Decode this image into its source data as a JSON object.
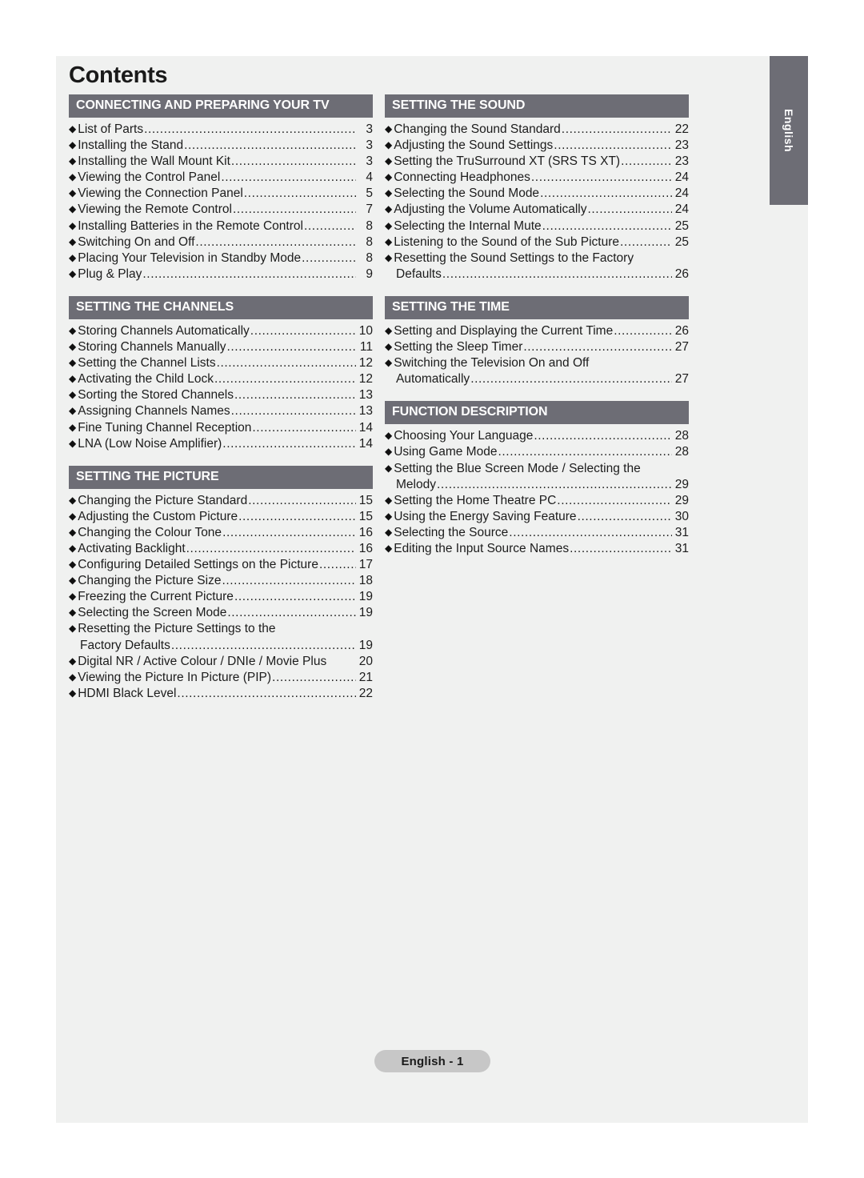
{
  "page": {
    "title": "Contents",
    "language_tab": "English",
    "footer": "English - 1",
    "header_bar_color": "#6d6d75",
    "sheet_color": "#f0f1f0",
    "footer_pill_color": "#c7c7c7",
    "bullet_glyph": "◆"
  },
  "columns": [
    {
      "name": "left",
      "sections": [
        {
          "heading": "CONNECTING AND PREPARING YOUR TV",
          "entries": [
            {
              "label": "List of Parts",
              "page": "3",
              "dots": true,
              "continuation": false
            },
            {
              "label": "Installing the Stand",
              "page": "3",
              "dots": true,
              "continuation": false
            },
            {
              "label": "Installing the Wall Mount Kit",
              "page": "3",
              "dots": true,
              "continuation": false
            },
            {
              "label": "Viewing the Control Panel",
              "page": "4",
              "dots": true,
              "continuation": false
            },
            {
              "label": "Viewing the Connection Panel",
              "page": "5",
              "dots": true,
              "continuation": false
            },
            {
              "label": "Viewing the Remote Control",
              "page": "7",
              "dots": true,
              "continuation": false
            },
            {
              "label": "Installing Batteries in the Remote Control",
              "page": "8",
              "dots": true,
              "continuation": false
            },
            {
              "label": "Switching On and Off",
              "page": "8",
              "dots": true,
              "continuation": false
            },
            {
              "label": "Placing Your Television in Standby Mode",
              "page": "8",
              "dots": true,
              "continuation": false
            },
            {
              "label": "Plug & Play",
              "page": "9",
              "dots": true,
              "continuation": false
            }
          ]
        },
        {
          "heading": "SETTING THE CHANNELS",
          "entries": [
            {
              "label": "Storing Channels Automatically",
              "page": "10",
              "dots": true,
              "continuation": false
            },
            {
              "label": "Storing Channels Manually",
              "page": "11",
              "dots": true,
              "continuation": false
            },
            {
              "label": "Setting the Channel Lists",
              "page": "12",
              "dots": true,
              "continuation": false
            },
            {
              "label": "Activating the Child Lock",
              "page": "12",
              "dots": true,
              "continuation": false
            },
            {
              "label": "Sorting the Stored Channels",
              "page": "13",
              "dots": true,
              "continuation": false
            },
            {
              "label": "Assigning Channels Names",
              "page": "13",
              "dots": true,
              "continuation": false
            },
            {
              "label": "Fine Tuning Channel Reception",
              "page": "14",
              "dots": true,
              "continuation": false
            },
            {
              "label": "LNA (Low Noise Amplifier)",
              "page": "14",
              "dots": true,
              "continuation": false
            }
          ]
        },
        {
          "heading": "SETTING THE PICTURE",
          "entries": [
            {
              "label": "Changing the Picture Standard",
              "page": "15",
              "dots": true,
              "continuation": false
            },
            {
              "label": "Adjusting the Custom Picture",
              "page": "15",
              "dots": true,
              "continuation": false
            },
            {
              "label": "Changing the Colour Tone",
              "page": "16",
              "dots": true,
              "continuation": false
            },
            {
              "label": "Activating Backlight",
              "page": "16",
              "dots": true,
              "continuation": false
            },
            {
              "label": "Configuring Detailed Settings on the Picture",
              "page": "17",
              "dots": true,
              "continuation": false
            },
            {
              "label": "Changing the Picture Size",
              "page": "18",
              "dots": true,
              "continuation": false
            },
            {
              "label": "Freezing the Current Picture",
              "page": "19",
              "dots": true,
              "continuation": false
            },
            {
              "label": "Selecting the Screen Mode",
              "page": "19",
              "dots": true,
              "continuation": false
            },
            {
              "label": "Resetting the Picture Settings to the",
              "page": "",
              "dots": false,
              "continuation": false
            },
            {
              "label": "Factory Defaults",
              "page": "19",
              "dots": true,
              "continuation": true
            },
            {
              "label": "Digital NR / Active Colour / DNIe / Movie Plus",
              "page": "20",
              "dots": false,
              "continuation": false
            },
            {
              "label": "Viewing the Picture In Picture (PIP)",
              "page": "21",
              "dots": true,
              "continuation": false
            },
            {
              "label": "HDMI Black Level",
              "page": "22",
              "dots": true,
              "continuation": false
            }
          ]
        }
      ]
    },
    {
      "name": "right",
      "sections": [
        {
          "heading": "SETTING THE SOUND",
          "entries": [
            {
              "label": "Changing the Sound Standard",
              "page": "22",
              "dots": true,
              "continuation": false
            },
            {
              "label": "Adjusting the Sound Settings",
              "page": "23",
              "dots": true,
              "continuation": false
            },
            {
              "label": "Setting the TruSurround XT (SRS TS XT)",
              "page": "23",
              "dots": true,
              "continuation": false
            },
            {
              "label": "Connecting Headphones",
              "page": "24",
              "dots": true,
              "continuation": false
            },
            {
              "label": "Selecting the Sound Mode",
              "page": "24",
              "dots": true,
              "continuation": false
            },
            {
              "label": "Adjusting the Volume Automatically",
              "page": "24",
              "dots": true,
              "continuation": false
            },
            {
              "label": "Selecting the Internal Mute",
              "page": "25",
              "dots": true,
              "continuation": false
            },
            {
              "label": "Listening to the Sound of the Sub Picture",
              "page": "25",
              "dots": true,
              "continuation": false
            },
            {
              "label": "Resetting the Sound Settings to the Factory",
              "page": "",
              "dots": false,
              "continuation": false
            },
            {
              "label": "Defaults",
              "page": "26",
              "dots": true,
              "continuation": true
            }
          ]
        },
        {
          "heading": "SETTING THE TIME",
          "entries": [
            {
              "label": "Setting and Displaying the Current Time",
              "page": "26",
              "dots": true,
              "continuation": false
            },
            {
              "label": "Setting the Sleep Timer",
              "page": "27",
              "dots": true,
              "continuation": false
            },
            {
              "label": "Switching the Television On and Off",
              "page": "",
              "dots": false,
              "continuation": false
            },
            {
              "label": "Automatically",
              "page": "27",
              "dots": true,
              "continuation": true
            }
          ]
        },
        {
          "heading": "FUNCTION DESCRIPTION",
          "entries": [
            {
              "label": "Choosing Your Language",
              "page": "28",
              "dots": true,
              "continuation": false
            },
            {
              "label": "Using Game Mode",
              "page": "28",
              "dots": true,
              "continuation": false
            },
            {
              "label": "Setting the Blue Screen Mode / Selecting the",
              "page": "",
              "dots": false,
              "continuation": false
            },
            {
              "label": "Melody",
              "page": "29",
              "dots": true,
              "continuation": true
            },
            {
              "label": "Setting the Home Theatre PC",
              "page": "29",
              "dots": true,
              "continuation": false
            },
            {
              "label": "Using the Energy Saving Feature",
              "page": "30",
              "dots": true,
              "continuation": false
            },
            {
              "label": "Selecting the Source",
              "page": "31",
              "dots": true,
              "continuation": false
            },
            {
              "label": "Editing the Input Source Names",
              "page": "31",
              "dots": true,
              "continuation": false
            }
          ]
        }
      ]
    }
  ]
}
